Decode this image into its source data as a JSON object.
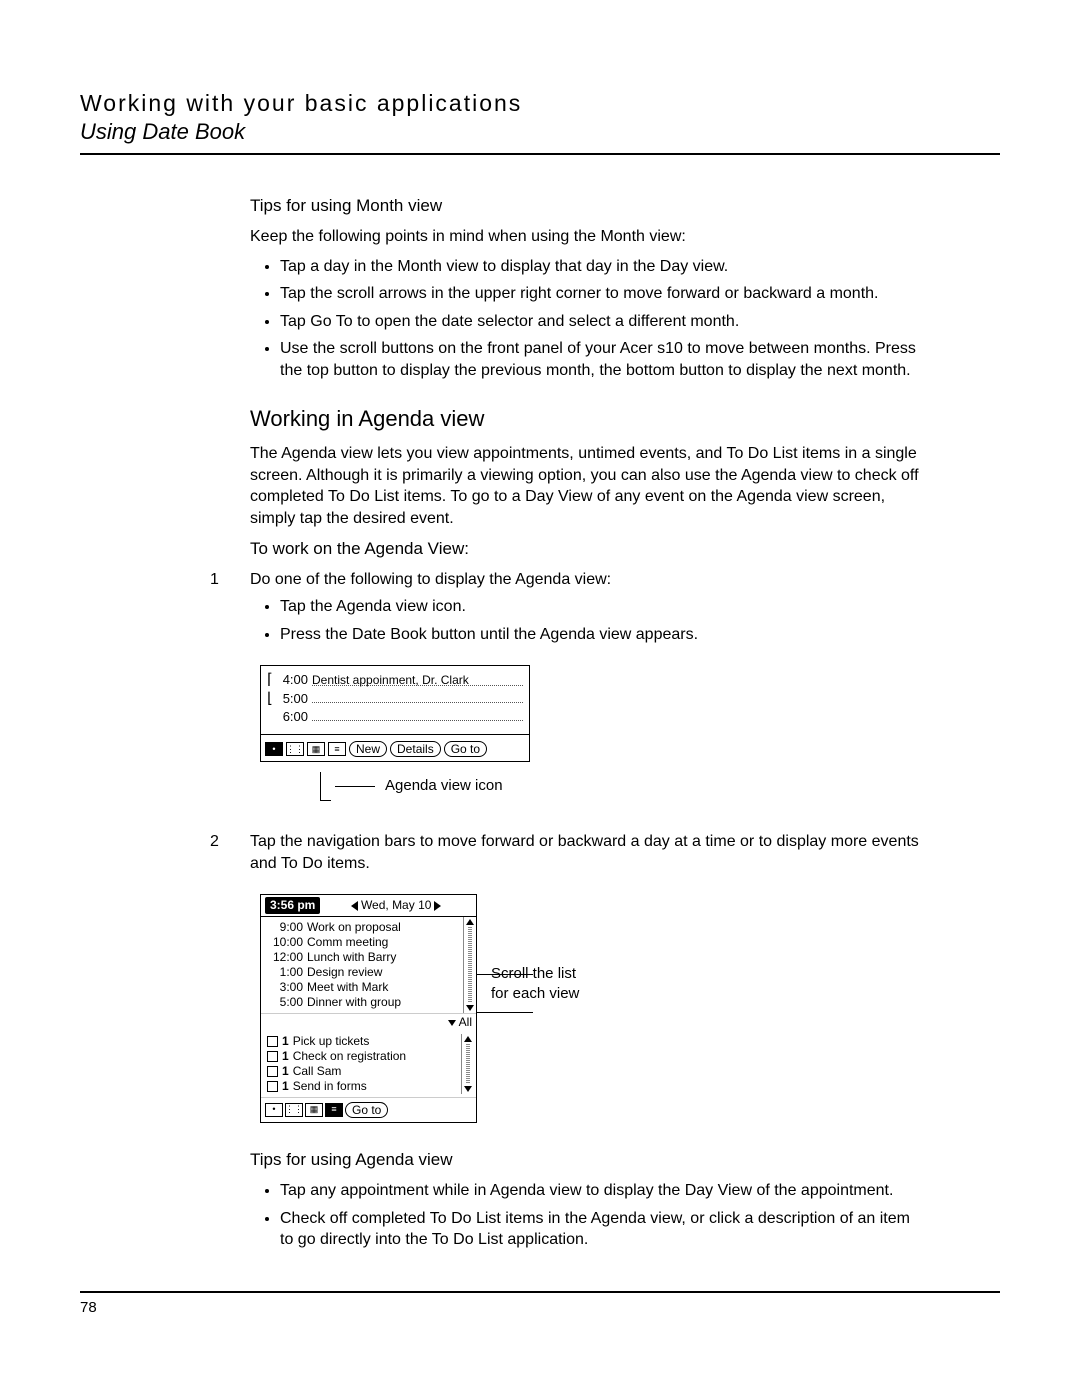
{
  "header": {
    "main": "Working with your basic applications",
    "sub": "Using Date Book"
  },
  "month_tips": {
    "title": "Tips for using Month view",
    "intro": "Keep the following points in mind when using the Month view:",
    "items": [
      "Tap a day in the Month view to display that day in the Day view.",
      "Tap the scroll arrows in the upper right corner to move forward or backward a month.",
      "Tap Go To to open the date selector and select a different month.",
      "Use the scroll buttons on the front panel of your Acer s10 to move between months. Press the top button to display the previous month, the bottom button to display the next month."
    ]
  },
  "agenda": {
    "title": "Working in Agenda view",
    "intro": "The Agenda view lets you view appointments, untimed events, and To Do List items in a single screen. Although it is primarily a viewing option, you can also use the Agenda view to check off completed To Do List items. To go to a Day View of any event on the Agenda view screen, simply tap the desired event.",
    "work_title": "To work on the Agenda View:",
    "step1_num": "1",
    "step1_text": "Do one of the following to display the Agenda view:",
    "step1_bullets": [
      "Tap the Agenda view icon.",
      "Press the Date Book button until the Agenda view appears."
    ],
    "step2_num": "2",
    "step2_text": "Tap the navigation bars to move forward or backward a day at a time or to display more events and To Do items."
  },
  "fig1": {
    "rows": [
      {
        "time": "4:00",
        "text": "Dentist appoinment, Dr. Clark"
      },
      {
        "time": "5:00",
        "text": ""
      },
      {
        "time": "6:00",
        "text": ""
      }
    ],
    "buttons": {
      "new": "New",
      "details": "Details",
      "goto": "Go to"
    },
    "callout": "Agenda view icon"
  },
  "fig2": {
    "time": "3:56 pm",
    "date": "Wed, May 10",
    "appts": [
      {
        "t": "9:00",
        "d": "Work on proposal"
      },
      {
        "t": "10:00",
        "d": "Comm meeting"
      },
      {
        "t": "12:00",
        "d": "Lunch with Barry"
      },
      {
        "t": "1:00",
        "d": "Design review"
      },
      {
        "t": "3:00",
        "d": "Meet with Mark"
      },
      {
        "t": "5:00",
        "d": "Dinner with group"
      }
    ],
    "all": "All",
    "todos": [
      {
        "p": "1",
        "d": "Pick up tickets"
      },
      {
        "p": "1",
        "d": "Check on registration"
      },
      {
        "p": "1",
        "d": "Call Sam"
      },
      {
        "p": "1",
        "d": "Send in forms"
      }
    ],
    "goto": "Go to",
    "side1": "Scroll the list",
    "side2": "for each view"
  },
  "agenda_tips": {
    "title": "Tips for using Agenda view",
    "items": [
      "Tap any appointment while in Agenda view to display the Day View of the appointment.",
      "Check off completed To Do List items in the Agenda view, or click a description of an item to go directly into the To Do List application."
    ]
  },
  "pagenum": "78"
}
